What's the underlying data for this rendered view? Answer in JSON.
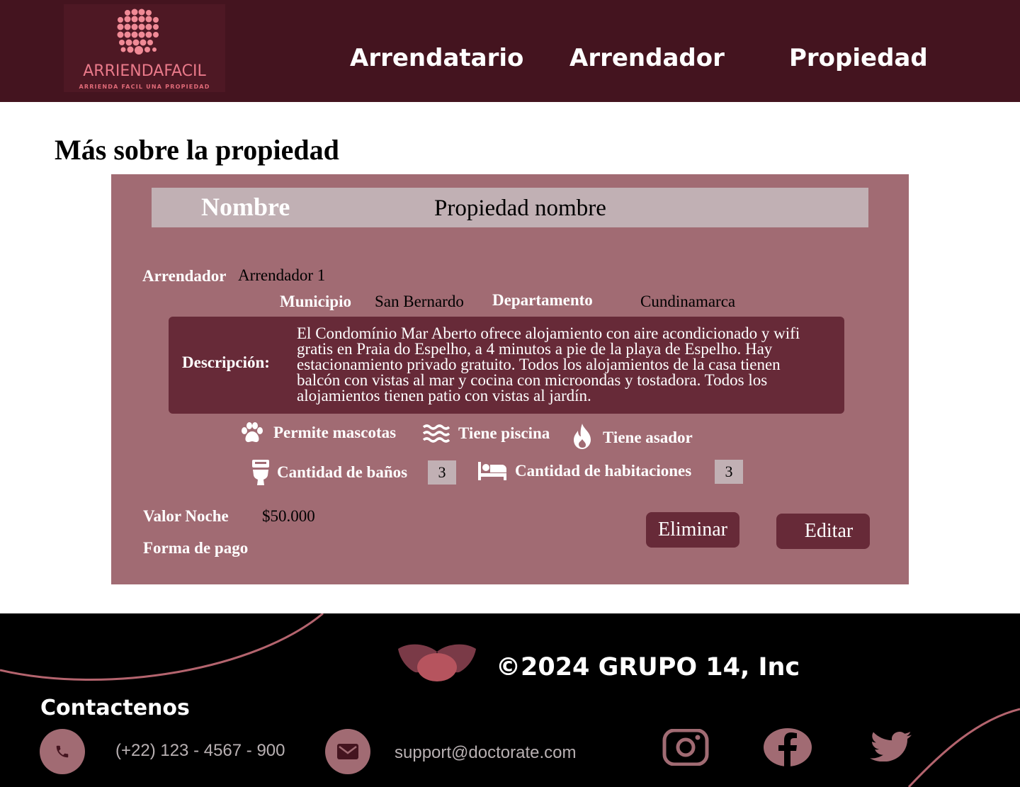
{
  "header": {
    "logo_text": "ARRIENDAFACIL",
    "logo_subtitle": "ARRIENDA FACIL UNA PROPIEDAD",
    "nav": [
      {
        "label": "Arrendatario"
      },
      {
        "label": "Arrendador"
      },
      {
        "label": "Propiedad"
      }
    ]
  },
  "page": {
    "title": "Más sobre la propiedad"
  },
  "property": {
    "name_label": "Nombre",
    "name_value": "Propiedad nombre",
    "landlord_label": "Arrendador",
    "landlord_value": "Arrendador 1",
    "municipality_label": "Municipio",
    "municipality_value": "San Bernardo",
    "department_label": "Departamento",
    "department_value": "Cundinamarca",
    "description_label": "Descripción:",
    "description_lines": [
      "El Condomínio Mar Aberto ofrece alojamiento con aire acondicionado y wifi",
      "gratis en Praia do Espelho, a 4 minutos a pie de la playa de Espelho. Hay",
      "estacionamiento privado gratuito. Todos los alojamientos de la casa tienen",
      "balcón con vistas al mar y cocina con microondas y tostadora. Todos los",
      "alojamientos tienen patio con vistas al jardín."
    ],
    "features": {
      "pets": "Permite mascotas",
      "pool": "Tiene piscina",
      "grill": "Tiene asador"
    },
    "bathrooms_label": "Cantidad de baños",
    "bathrooms_value": "3",
    "rooms_label": "Cantidad de habitaciones",
    "rooms_value": "3",
    "price_label": "Valor Noche",
    "price_value": "$50.000",
    "payment_label": "Forma de pago",
    "delete_button": "Eliminar",
    "edit_button": "Editar"
  },
  "footer": {
    "copyright": "©2024 GRUPO 14, Inc",
    "contact_title": "Contactenos",
    "phone": "(+22) 123 - 4567 - 900",
    "email": "support@doctorate.com"
  },
  "colors": {
    "header_bg": "#44141f",
    "card_bg": "#a16b73",
    "dark_accent": "#672a38",
    "light_box": "#c1b0b4",
    "footer_bg": "#000000"
  },
  "icons": [
    "logo-dots-icon",
    "paw-icon",
    "waves-icon",
    "flame-icon",
    "toilet-icon",
    "bed-icon",
    "phone-icon",
    "mail-icon",
    "instagram-icon",
    "facebook-icon",
    "twitter-icon",
    "butterfly-logo-icon"
  ]
}
